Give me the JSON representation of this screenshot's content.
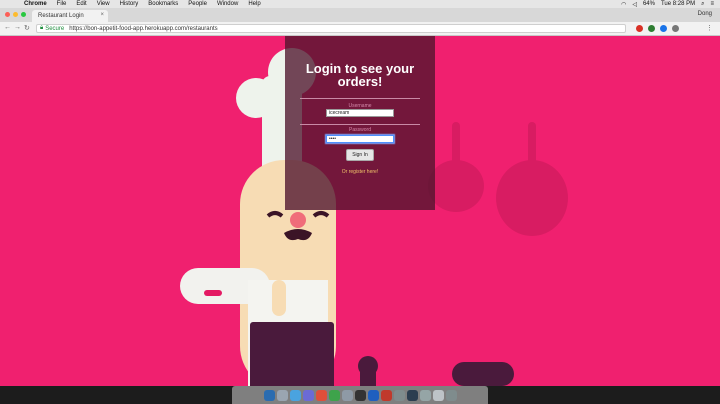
{
  "menubar": {
    "app": "Chrome",
    "items": [
      "File",
      "Edit",
      "View",
      "History",
      "Bookmarks",
      "People",
      "Window",
      "Help"
    ],
    "battery": "64%",
    "clock": "Tue 8:28 PM"
  },
  "browser": {
    "tab_title": "Restaurant Login",
    "profile": "Dong",
    "secure_label": "Secure",
    "url": "https://bon-appetit-food-app.herokuapp.com/restaurants"
  },
  "login": {
    "title": "Login to see your orders!",
    "username_label": "Username",
    "username_value": "icecream",
    "password_label": "Password",
    "password_value": "••••",
    "signin_label": "Sign In",
    "register_link": "Or register here!"
  },
  "colors": {
    "page_bg": "#f0206f",
    "panel_bg": "#50142d",
    "link": "#f0c36a"
  },
  "icons": {
    "apple": "apple-icon",
    "back": "back-arrow-icon",
    "forward": "forward-arrow-icon",
    "reload": "reload-icon",
    "lock": "lock-icon"
  }
}
